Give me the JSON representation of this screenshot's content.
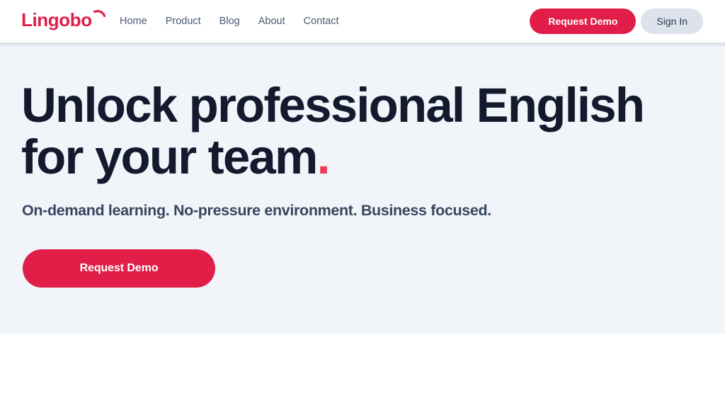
{
  "site": {
    "brand": "Lingobo",
    "brand_icon": "swoosh-accent-icon",
    "brand_color": "#e0204a"
  },
  "header": {
    "nav": [
      {
        "label": "Home"
      },
      {
        "label": "Product"
      },
      {
        "label": "Blog"
      },
      {
        "label": "About"
      },
      {
        "label": "Contact"
      }
    ],
    "request_demo_label": "Request Demo",
    "sign_in_label": "Sign In",
    "colors": {
      "background": "#ffffff",
      "nav_text": "#4a5a73",
      "demo_button": "#e01e47",
      "signin_button": "#dde3ed"
    }
  },
  "hero": {
    "title_line1": "Unlock professional English",
    "title_line2": "for your team",
    "title_period": ".",
    "subtitle": "On-demand learning. No-pressure environment. Business focused.",
    "cta_label": "Request Demo",
    "colors": {
      "background": "#f1f4f9",
      "title": "#141a2e",
      "period": "#ef3b59",
      "subtitle": "#37465f",
      "cta": "#e01e47"
    }
  }
}
